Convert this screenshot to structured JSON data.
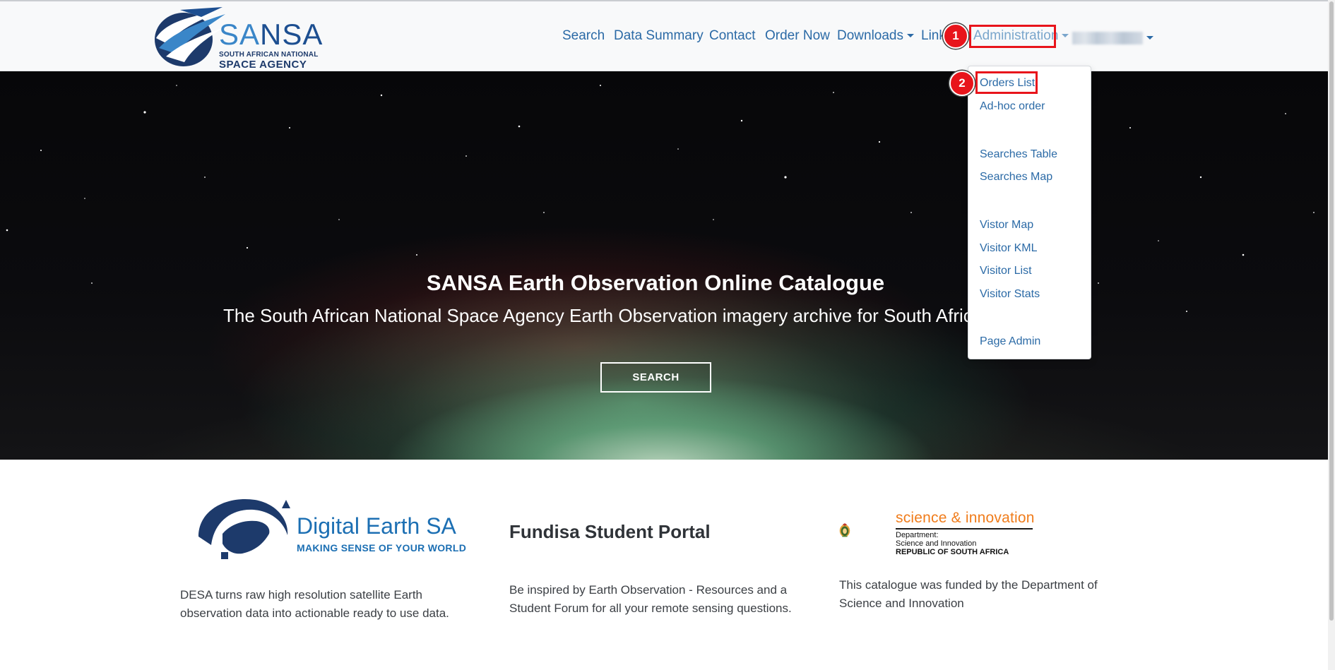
{
  "brand": {
    "name_part1": "SA",
    "name_part2": "NSA",
    "subtitle1": "SOUTH AFRICAN NATIONAL",
    "subtitle2": "SPACE AGENCY"
  },
  "nav": {
    "items": [
      {
        "label": "Search"
      },
      {
        "label": "Data Summary"
      },
      {
        "label": "Contact"
      },
      {
        "label": "Order Now"
      },
      {
        "label": "Downloads"
      },
      {
        "label": "Link"
      },
      {
        "label": "Administration"
      }
    ]
  },
  "annotations": {
    "badge1": "1",
    "badge2": "2",
    "highlight_color": "#e8141b"
  },
  "admin_menu": {
    "items": [
      {
        "label": "Orders List"
      },
      {
        "label": "Ad-hoc order"
      },
      {
        "label": "Searches Table"
      },
      {
        "label": "Searches Map"
      },
      {
        "label": "Vistor Map"
      },
      {
        "label": "Visitor KML"
      },
      {
        "label": "Visitor List"
      },
      {
        "label": "Visitor Stats"
      },
      {
        "label": "Page Admin"
      }
    ]
  },
  "hero": {
    "title": "SANSA Earth Observation Online Catalogue",
    "subtitle": "The South African National Space Agency Earth Observation imagery archive for South Africa",
    "button_label": "SEARCH"
  },
  "sections": {
    "desa": {
      "logo_name": "Digital Earth SA",
      "logo_tagline": "MAKING SENSE OF YOUR WORLD",
      "text": "DESA turns raw high resolution satellite Earth observation data into actionable ready to use data."
    },
    "fundisa": {
      "title": "Fundisa Student Portal",
      "text": "Be inspired by Earth Observation - Resources and a Student Forum for all your remote sensing questions."
    },
    "dsi": {
      "brand": "science & innovation",
      "line1": "Department:",
      "line2": "Science and Innovation",
      "line3": "REPUBLIC OF SOUTH AFRICA",
      "text": "This catalogue was funded by the Department of Science and Innovation"
    }
  },
  "colors": {
    "link": "#2b6aa6",
    "brand_dark": "#1d4f91",
    "dsi_orange": "#f07c1b"
  }
}
